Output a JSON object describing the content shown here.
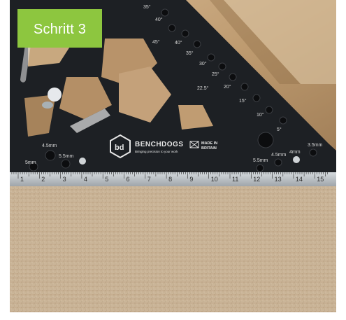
{
  "badge": {
    "text": "Schritt 3",
    "color": "#8dc63f"
  },
  "brand": {
    "name": "BENCHDOGS",
    "tagline": "Bringing precision to your work",
    "made_in_1": "MADE IN",
    "made_in_2": "BRITAIN",
    "logo_letters": "bd"
  },
  "scale": {
    "numbers": [
      "1",
      "2",
      "3",
      "4",
      "5",
      "6",
      "7",
      "8",
      "9",
      "10",
      "11",
      "12",
      "13",
      "14",
      "15"
    ]
  },
  "angles": [
    "35°",
    "40°",
    "45°",
    "40°",
    "35°",
    "30°",
    "25°",
    "22.5°",
    "20°",
    "15°",
    "10°",
    "5°"
  ],
  "hole_labels": {
    "left": [
      "5mm",
      "4.5mm",
      "5.5mm"
    ],
    "right": [
      "5.5mm",
      "4.5mm",
      "4mm",
      "3.5mm"
    ]
  },
  "colors": {
    "wood_light": "#c5a47c",
    "wood_dark": "#a7845a",
    "square_black": "#1d2024",
    "mdf": "#c8b396",
    "ruler": "#b9bec2"
  }
}
